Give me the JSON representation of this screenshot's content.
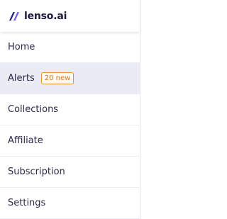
{
  "brand": {
    "logo_icon": "lenso-logo-icon",
    "name": "lenso.ai",
    "accent_colors": [
      "#1e2a78",
      "#8a5cf6"
    ]
  },
  "nav": {
    "items": [
      {
        "label": "Home",
        "active": false
      },
      {
        "label": "Alerts",
        "active": true,
        "badge": "20 new"
      },
      {
        "label": "Collections",
        "active": false
      },
      {
        "label": "Affiliate",
        "active": false
      },
      {
        "label": "Subscription",
        "active": false
      },
      {
        "label": "Settings",
        "active": false
      }
    ]
  },
  "colors": {
    "active_background": "#ebebf4",
    "badge": "#d07a1f",
    "text": "#2b2a4a"
  }
}
